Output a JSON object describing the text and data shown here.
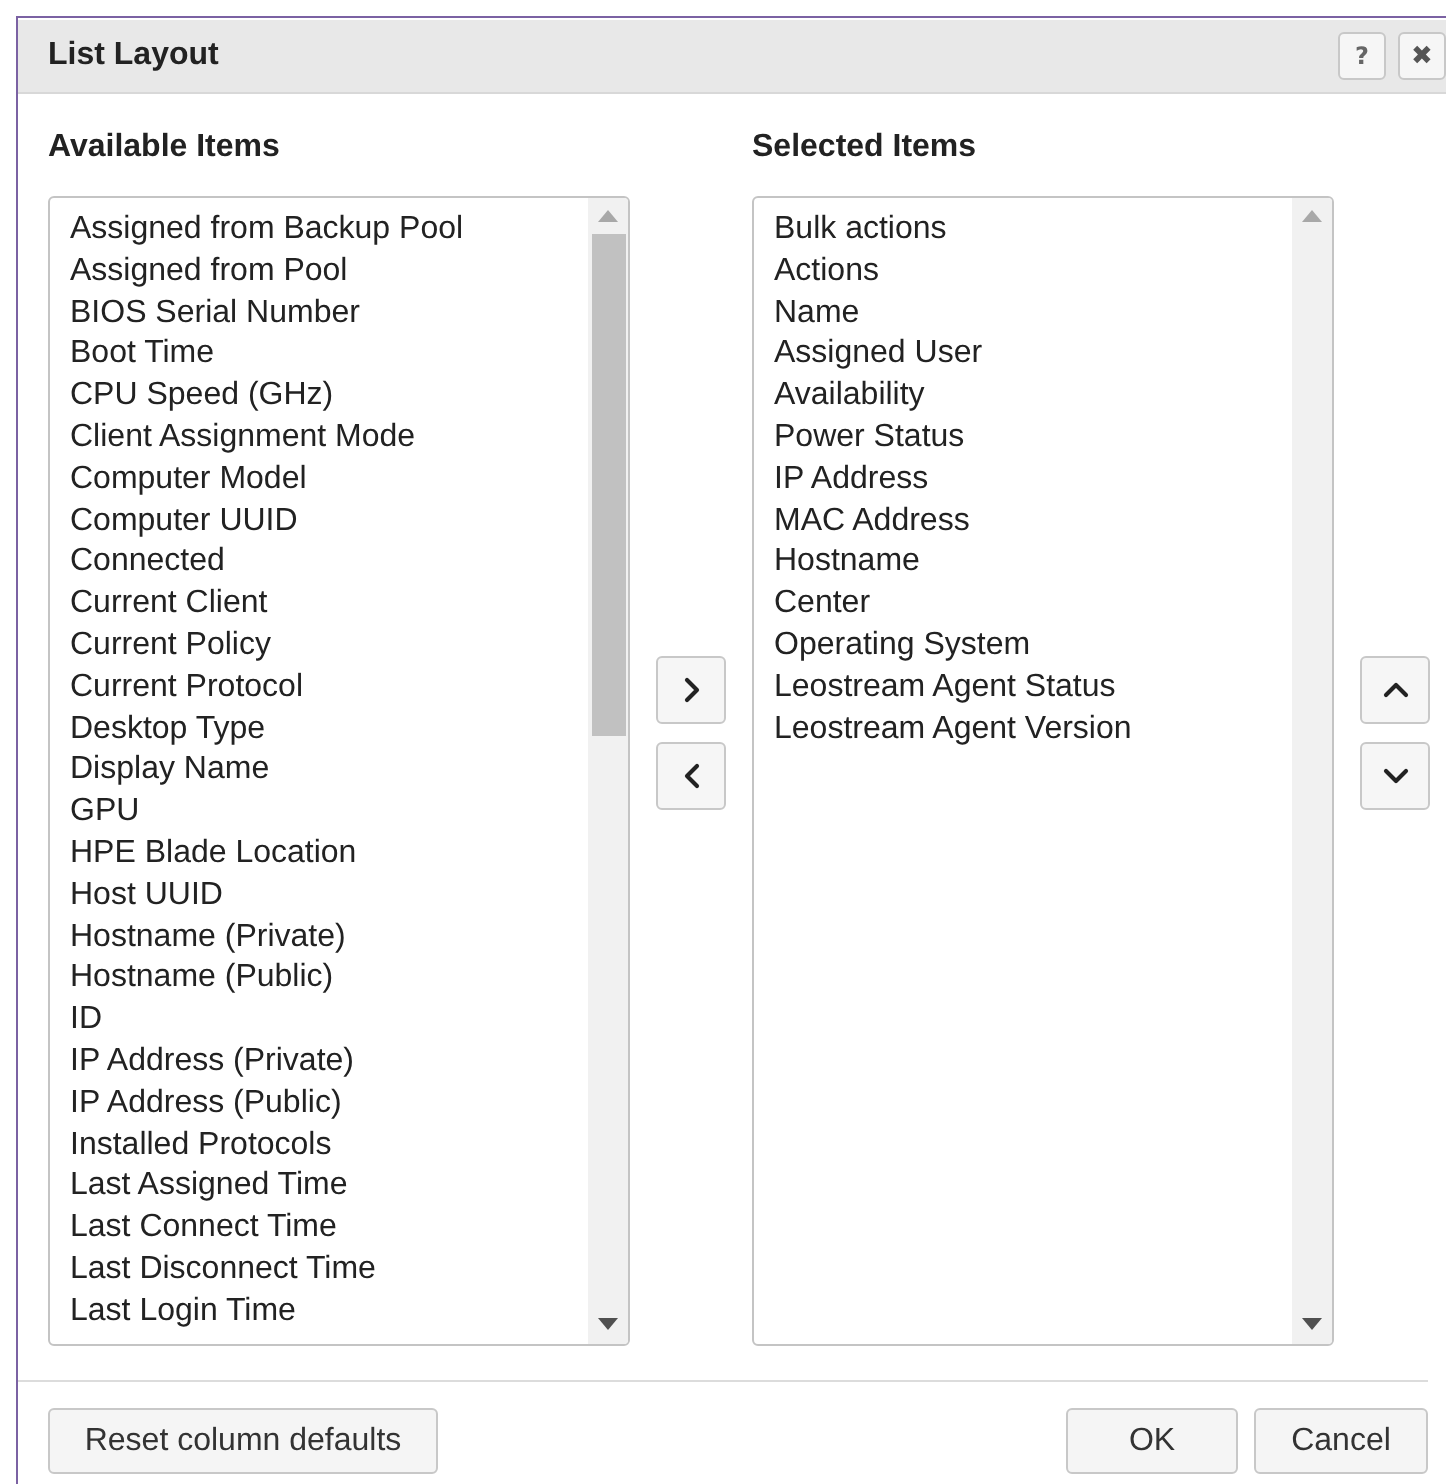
{
  "window": {
    "title": "List Layout",
    "buttons": [
      {
        "kind": "help",
        "label": "?"
      },
      {
        "kind": "close",
        "label": "✖"
      }
    ]
  },
  "available": {
    "heading": "Available Items",
    "items": [
      "Assigned from Backup Pool",
      "Assigned from Pool",
      "BIOS Serial Number",
      "Boot Time",
      "CPU Speed (GHz)",
      "Client Assignment Mode",
      "Computer Model",
      "Computer UUID",
      "Connected",
      "Current Client",
      "Current Policy",
      "Current Protocol",
      "Desktop Type",
      "Display Name",
      "GPU",
      "HPE Blade Location",
      "Host UUID",
      "Hostname (Private)",
      "Hostname (Public)",
      "ID",
      "IP Address (Private)",
      "IP Address (Public)",
      "Installed Protocols",
      "Last Assigned Time",
      "Last Connect Time",
      "Last Disconnect Time",
      "Last Login Time"
    ]
  },
  "move_buttons": [
    {
      "kind": "right"
    },
    {
      "kind": "left"
    }
  ],
  "selected": {
    "heading": "Selected Items",
    "items": [
      "Bulk actions",
      "Actions",
      "Name",
      "Assigned User",
      "Availability",
      "Power Status",
      "IP Address",
      "MAC Address",
      "Hostname",
      "Center",
      "Operating System",
      "Leostream Agent Status",
      "Leostream Agent Version"
    ]
  },
  "order_buttons": [
    {
      "kind": "up"
    },
    {
      "kind": "down"
    }
  ],
  "footer": {
    "reset": "Reset column defaults",
    "ok": "OK",
    "cancel": "Cancel"
  }
}
